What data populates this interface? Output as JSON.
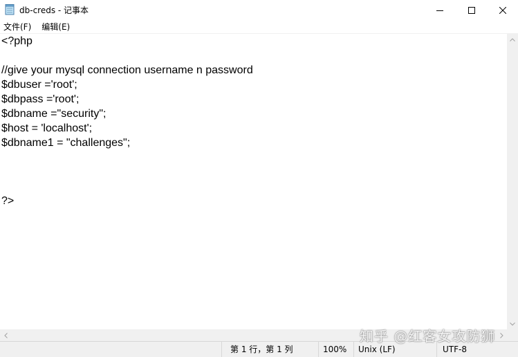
{
  "window": {
    "title": "db-creds - 记事本",
    "icon": "notepad-icon",
    "controls": {
      "minimize": "minimize-icon",
      "maximize": "maximize-icon",
      "close": "close-icon"
    }
  },
  "menu": {
    "items": [
      {
        "label": "文件(F)"
      },
      {
        "label": "编辑(E)"
      }
    ]
  },
  "editor": {
    "lines": [
      "<?php",
      "",
      "//give your mysql connection username n password",
      "$dbuser ='root';",
      "$dbpass ='root';",
      "$dbname =\"security\";",
      "$host = 'localhost';",
      "$dbname1 = \"challenges\";",
      "",
      "",
      "",
      "?>"
    ]
  },
  "status": {
    "position": "第 1 行，第 1 列",
    "zoom": "100%",
    "line_ending": "Unix (LF)",
    "encoding": "UTF-8"
  },
  "watermark": "知乎 @红客女攻防狮"
}
